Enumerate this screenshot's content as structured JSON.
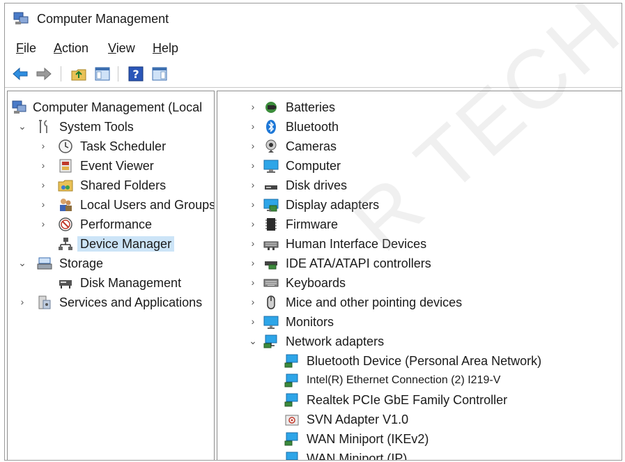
{
  "window": {
    "title": "Computer Management"
  },
  "menu": [
    {
      "acc": "F",
      "rest": "ile"
    },
    {
      "acc": "A",
      "rest": "ction"
    },
    {
      "acc": "V",
      "rest": "iew"
    },
    {
      "acc": "H",
      "rest": "elp"
    }
  ],
  "tree": {
    "root": "Computer Management (Local",
    "system_tools": "System Tools",
    "task_scheduler": "Task Scheduler",
    "event_viewer": "Event Viewer",
    "shared_folders": "Shared Folders",
    "local_users": "Local Users and Groups",
    "performance": "Performance",
    "device_manager": "Device Manager",
    "storage": "Storage",
    "disk_management": "Disk Management",
    "services": "Services and Applications"
  },
  "devices": {
    "batteries": "Batteries",
    "bluetooth": "Bluetooth",
    "cameras": "Cameras",
    "computer": "Computer",
    "disk_drives": "Disk drives",
    "display_adapters": "Display adapters",
    "firmware": "Firmware",
    "hid": "Human Interface Devices",
    "ide": "IDE ATA/ATAPI controllers",
    "keyboards": "Keyboards",
    "mice": "Mice and other pointing devices",
    "monitors": "Monitors",
    "network_adapters": "Network adapters"
  },
  "network_children": [
    "Bluetooth Device (Personal Area Network)",
    "Intel(R) Ethernet Connection (2) I219-V",
    "Realtek PCIe GbE Family Controller",
    "SVN Adapter V1.0",
    "WAN Miniport (IKEv2)",
    "WAN Miniport (IP)"
  ],
  "watermark": "R TECH CO",
  "colors": {
    "selection": "#cce4f7",
    "accent": "#1e78d7"
  }
}
